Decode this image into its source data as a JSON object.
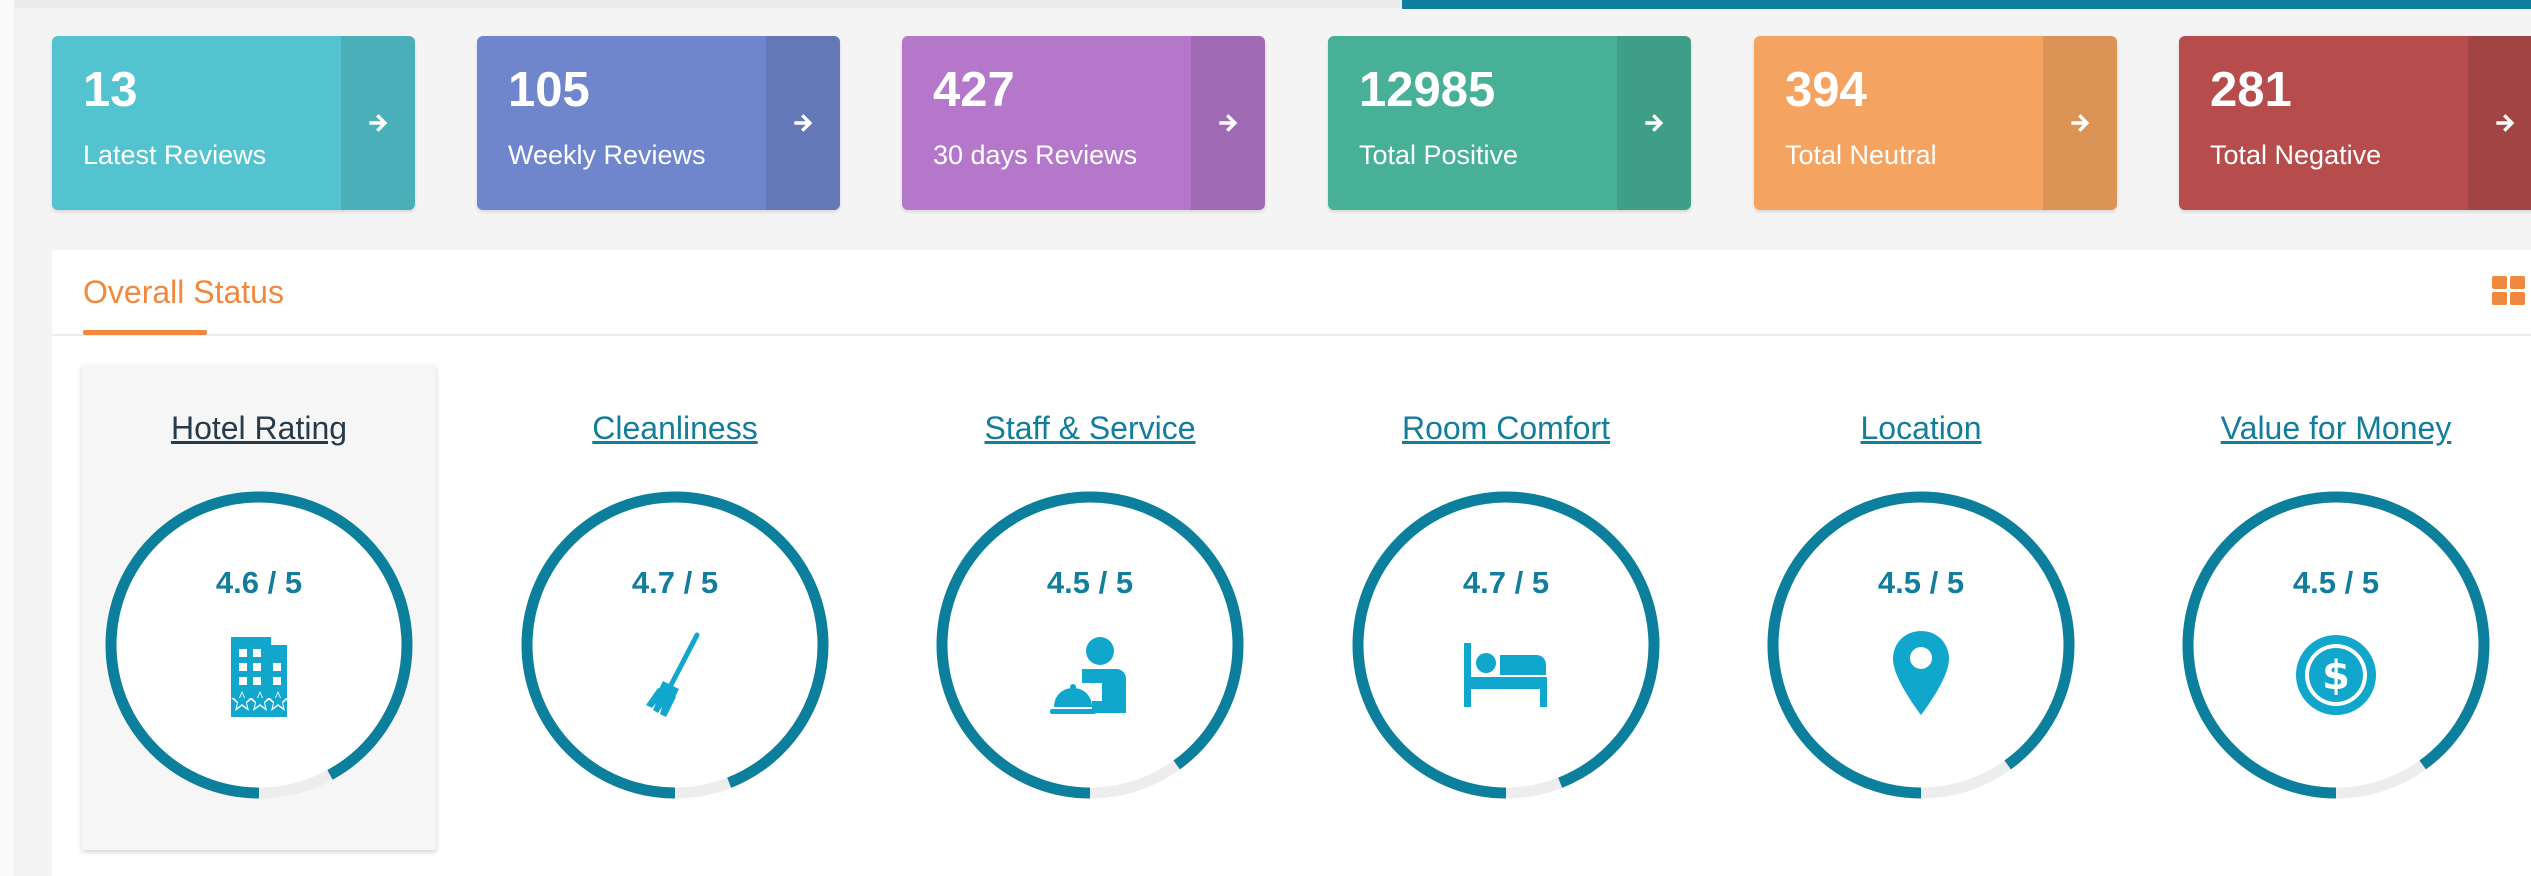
{
  "stats": [
    {
      "value": "13",
      "label": "Latest Reviews",
      "color": "#54c3d0"
    },
    {
      "value": "105",
      "label": "Weekly Reviews",
      "color": "#7086cc"
    },
    {
      "value": "427",
      "label": "30 days Reviews",
      "color": "#b477ca"
    },
    {
      "value": "12985",
      "label": "Total Positive",
      "color": "#47b096"
    },
    {
      "value": "394",
      "label": "Total Neutral",
      "color": "#f4a460"
    },
    {
      "value": "281",
      "label": "Total Negative",
      "color": "#b64c4c"
    }
  ],
  "panel": {
    "title": "Overall Status",
    "title_color": "#f0883f",
    "menu_icon": "grid-icon"
  },
  "ratings": [
    {
      "title": "Hotel Rating",
      "score": "4.6 / 5",
      "value": 4.6,
      "max": 5,
      "icon": "hotel-stars-icon"
    },
    {
      "title": "Cleanliness",
      "score": "4.7 / 5",
      "value": 4.7,
      "max": 5,
      "icon": "broom-icon"
    },
    {
      "title": "Staff & Service",
      "score": "4.5 / 5",
      "value": 4.5,
      "max": 5,
      "icon": "concierge-icon"
    },
    {
      "title": "Room Comfort",
      "score": "4.7 / 5",
      "value": 4.7,
      "max": 5,
      "icon": "bed-icon"
    },
    {
      "title": "Location",
      "score": "4.5 / 5",
      "value": 4.5,
      "max": 5,
      "icon": "map-pin-icon"
    },
    {
      "title": "Value for Money",
      "score": "4.5 / 5",
      "value": 4.5,
      "max": 5,
      "icon": "dollar-coin-icon"
    }
  ],
  "gauge_color": "#0c7f9c",
  "gauge_track_color": "#ededed",
  "icon_color": "#11a6cc"
}
